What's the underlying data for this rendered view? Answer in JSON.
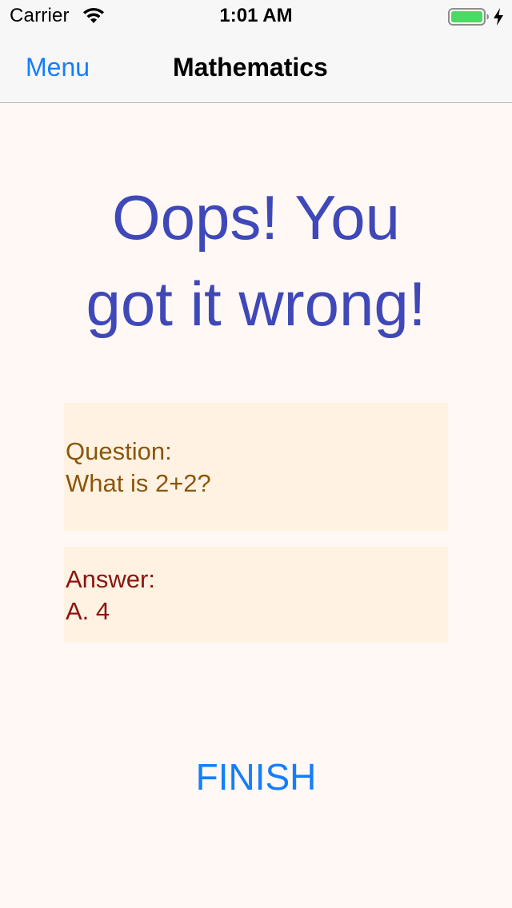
{
  "status_bar": {
    "carrier": "Carrier",
    "time": "1:01 AM",
    "battery_color": "#4cd964",
    "icons": [
      "wifi-icon",
      "battery-icon",
      "charging-bolt-icon"
    ]
  },
  "nav": {
    "back_label": "Menu",
    "title": "Mathematics"
  },
  "result": {
    "line1": "Oops! You",
    "line2": "got it wrong!"
  },
  "question": {
    "label": "Question:",
    "text": "What is 2+2?"
  },
  "answer": {
    "label": "Answer:",
    "text": "A. 4"
  },
  "finish_label": "FINISH",
  "colors": {
    "accent": "#147efb",
    "title": "#3f48b8",
    "question_text": "#8b560c",
    "answer_text": "#8b1410",
    "card_bg": "#fff2e2",
    "page_bg": "#fff8f4"
  }
}
